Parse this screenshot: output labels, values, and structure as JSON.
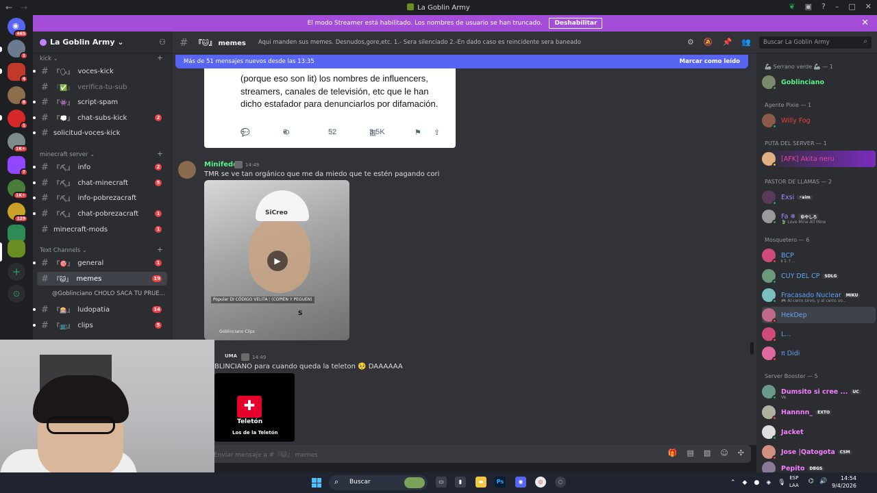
{
  "window": {
    "title": "La Goblin Army"
  },
  "banner": {
    "text": "El modo Streamer está habilitado. Los nombres de usuario se han truncado.",
    "button": "Deshabilitar",
    "close": "✕"
  },
  "rail": {
    "badges": [
      "465",
      "1",
      "4",
      "8",
      "1",
      "1K+",
      "7",
      "1K+",
      "129"
    ]
  },
  "server": {
    "name": "La Goblin Army ⌄"
  },
  "categories": {
    "kick": "kick ⌄",
    "minecraft": "minecraft server ⌄",
    "text": "Text Channels ⌄"
  },
  "channels": {
    "voces_kick": {
      "name": "voces-kick",
      "emoji": "『🗣』"
    },
    "verifica": {
      "name": "verifica-tu-sub",
      "emoji": "『✅』"
    },
    "script": {
      "name": "script-spam",
      "emoji": "『👾』"
    },
    "chat_subs": {
      "name": "chat-subs-kick",
      "emoji": "『💭』",
      "badge": "2"
    },
    "solicitud": {
      "name": "solicitud-voces-kick"
    },
    "info": {
      "name": "info",
      "emoji": "『⛏』",
      "badge": "2"
    },
    "chat_mc": {
      "name": "chat-minecraft",
      "emoji": "『⛏』",
      "badge": "5"
    },
    "info_pobre": {
      "name": "info-pobrezacraft",
      "emoji": "『⛏』"
    },
    "chat_pobre": {
      "name": "chat-pobrezacraft",
      "emoji": "『⛏』",
      "badge": "1"
    },
    "mods": {
      "name": "minecraft-mods",
      "badge": "1"
    },
    "general": {
      "name": "general",
      "emoji": "『🎯』",
      "badge": "1"
    },
    "memes": {
      "name": "memes",
      "emoji": "『🐱』",
      "badge": "19"
    },
    "thread": {
      "name": "@Goblinciano CHOLO SACA TU PRUE..."
    },
    "ludopatia": {
      "name": "ludopatia",
      "emoji": "『🎰』",
      "badge": "14"
    },
    "clips": {
      "name": "clips",
      "emoji": "『📺』",
      "badge": "5"
    }
  },
  "header": {
    "channel": "『🐱』 memes",
    "topic": "Aqui manden sus memes. Desnudos,gore,etc. 1.- Sera silenciado 2.-En dado caso es reincidente sera baneado",
    "search_placeholder": "Buscar La Goblin Army"
  },
  "newbar": {
    "text": "Más de 51 mensajes nuevos desde las 13:35",
    "mark": "Marcar como leído"
  },
  "embed": {
    "text": "(porque eso son lit) los nombres de influencers, streamers, canales de televisión, etc que le han dicho estafador para denunciarlos por difamación.",
    "replies": "6",
    "reposts": "6",
    "likes": "52",
    "views": "3.5K"
  },
  "messages": [
    {
      "user": "Minifedo",
      "time": "14:49",
      "text": "TMR se ve tan orgánico que me da miedo que te estén pagando cori",
      "color": "#57f287"
    },
    {
      "user": "UMA",
      "time": "14:49",
      "text": "BLINCIANO para cuando queda la teleton 🥺 DAAAAAA",
      "color": "#dbdee1"
    }
  ],
  "video": {
    "hat_text": "SiCreo",
    "caption": "Popular DI CÓDIGO VELITA 🕯 (COPIEN Y PEGUEN)",
    "letter": "S",
    "channel": "Goblinciano Clips"
  },
  "teleton": {
    "title": "Teletón",
    "subtitle": "Los de la Teletón"
  },
  "composer": {
    "placeholder": "Enviar mensaje a #『🐱』 memes"
  },
  "members": {
    "roles": [
      "🦾 Serrano verde 🦾 — 1",
      "Agente Pixie — 1",
      "PUTA DEL SERVER — 1",
      "PASTOR DE LLAMAS — 2",
      "Mosquetero — 6",
      "Server Booster — 5"
    ],
    "list": [
      {
        "name": "Goblinciano",
        "color": "#57f287"
      },
      {
        "name": "Willy Fog",
        "color": "#f23f43"
      },
      {
        "name": "[AFK] Akita neru",
        "color": "#eb459e"
      },
      {
        "name": "Exsi",
        "color": "#a78bfa",
        "tag": "⚡aim"
      },
      {
        "name": "Fa ❄",
        "color": "#a78bfa",
        "tag": "ゆやしろ",
        "sub": "🍃 Love Mine All Mine"
      },
      {
        "name": "BCP",
        "color": "#5ea4f7",
        "sub": "ℹ 1 ↑..."
      },
      {
        "name": "CUY DEL CP",
        "color": "#5ea4f7",
        "tag": "SDLG"
      },
      {
        "name": "Fracasado Nuclear",
        "color": "#5ea4f7",
        "tag": "MIKU",
        "sub": "🎮 Al cerro sirvo, y al cerro vo..."
      },
      {
        "name": "HekDep",
        "color": "#5ea4f7"
      },
      {
        "name": "L...",
        "color": "#5ea4f7"
      },
      {
        "name": "π Didi",
        "color": "#5ea4f7"
      },
      {
        "name": "Dumsito si cree ...",
        "color": "#f47fff",
        "tag": "UC",
        "sub": "Ve"
      },
      {
        "name": "Hannnn_",
        "color": "#f47fff",
        "tag": "EXTO"
      },
      {
        "name": "Jacket",
        "color": "#f47fff"
      },
      {
        "name": "Jose |Qatogota",
        "color": "#f47fff",
        "tag": "CSM"
      },
      {
        "name": "Pepito",
        "color": "#f47fff",
        "tag": "DBGS"
      }
    ]
  },
  "taskbar": {
    "search": "Buscar",
    "lang1": "ESP",
    "lang2": "LAA",
    "time": "14:54",
    "date": "9/4/2026"
  }
}
